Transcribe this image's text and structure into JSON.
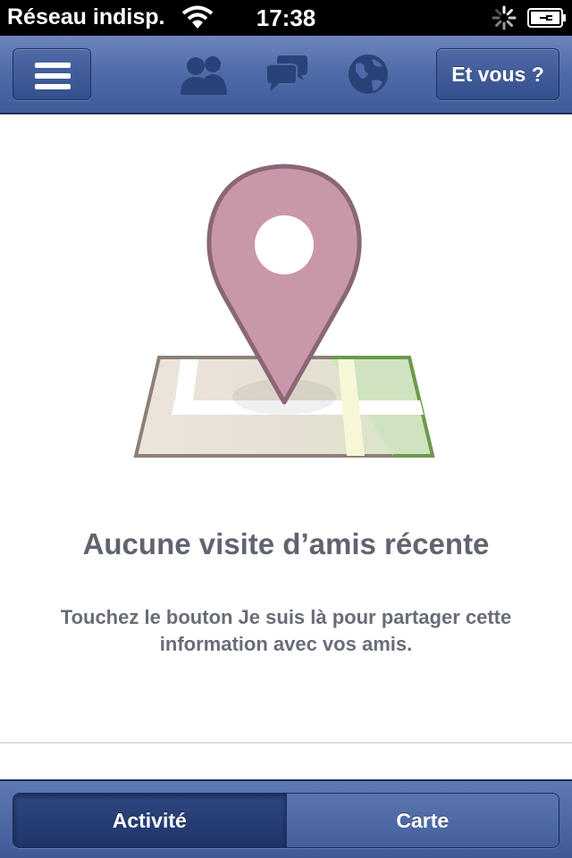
{
  "status_bar": {
    "carrier": "Réseau indisp.",
    "time": "17:38"
  },
  "nav": {
    "menu_icon": "hamburger-icon",
    "icons": [
      "friend-requests-icon",
      "messages-icon",
      "notifications-globe-icon"
    ],
    "right_button_label": "Et vous ?"
  },
  "main": {
    "illustration_icon": "map-pin-icon",
    "title": "Aucune visite d’amis récente",
    "description_line1": "Touchez le bouton Je suis là pour partager cette",
    "description_line2": "information avec vos amis."
  },
  "bottom_tabs": {
    "items": [
      {
        "label": "Activité",
        "selected": true
      },
      {
        "label": "Carte",
        "selected": false
      }
    ]
  },
  "colors": {
    "nav_bar": "#4e6aa8",
    "pin": "#c997aa",
    "text_gray": "#5f646e"
  }
}
